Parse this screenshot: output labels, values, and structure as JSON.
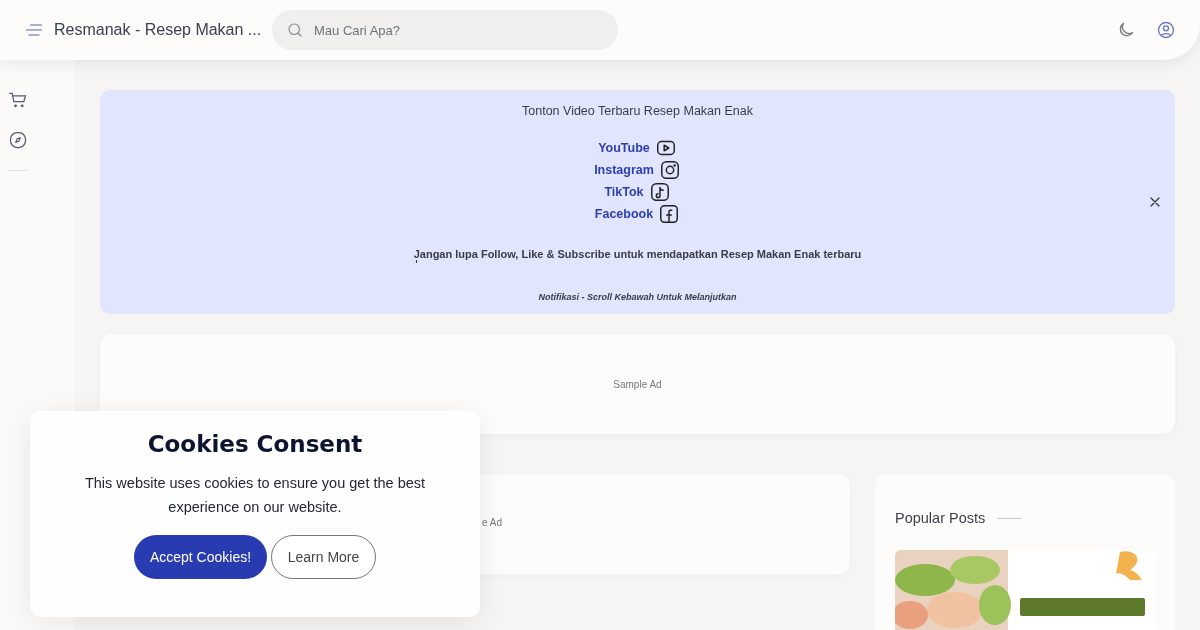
{
  "header": {
    "title": "Resmanak - Resep Makan ...",
    "search_placeholder": "Mau Cari Apa?"
  },
  "notification": {
    "title": "Tonton Video Terbaru Resep Makan Enak",
    "links": [
      {
        "label": "YouTube",
        "kind": "youtube"
      },
      {
        "label": "Instagram",
        "kind": "instagram"
      },
      {
        "label": "TikTok",
        "kind": "tiktok"
      },
      {
        "label": "Facebook",
        "kind": "facebook"
      }
    ],
    "message": "Jangan lupa Follow, Like & Subscribe untuk mendapatkan Resep Makan Enak terbaru",
    "mark": "'",
    "footer": "Notifikasi - Scroll Kebawah Untuk Melanjutkan"
  },
  "ads": [
    "Sample Ad",
    "e Ad"
  ],
  "popular_posts": {
    "title": "Popular Posts"
  },
  "cookie_consent": {
    "title": "Cookies Consent",
    "text": "This website uses cookies to ensure you get the best experience on our website.",
    "buttons": [
      {
        "label": "Accept Cookies!",
        "kind": "primary"
      },
      {
        "label": "Learn More",
        "kind": "outline"
      }
    ]
  }
}
